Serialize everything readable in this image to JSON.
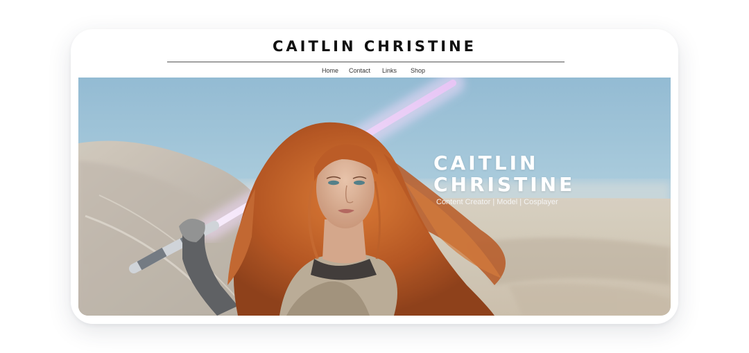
{
  "site": {
    "title": "CAITLIN CHRISTINE"
  },
  "nav": {
    "items": [
      {
        "label": "Home"
      },
      {
        "label": "Contact"
      },
      {
        "label": "Links"
      },
      {
        "label": "Shop"
      }
    ]
  },
  "hero": {
    "title_line1": "CAITLIN",
    "title_line2": "CHRISTINE",
    "subtitle": "Content Creator | Model | Cosplayer",
    "image": "photo of a red-haired cosplayer holding a pink lightsaber in a desert",
    "colors": {
      "sky": "#9fc3d8",
      "hair": "#b8541e",
      "lightsaber_glow": "#e9c8f5",
      "sand": "#d8ccba"
    }
  }
}
